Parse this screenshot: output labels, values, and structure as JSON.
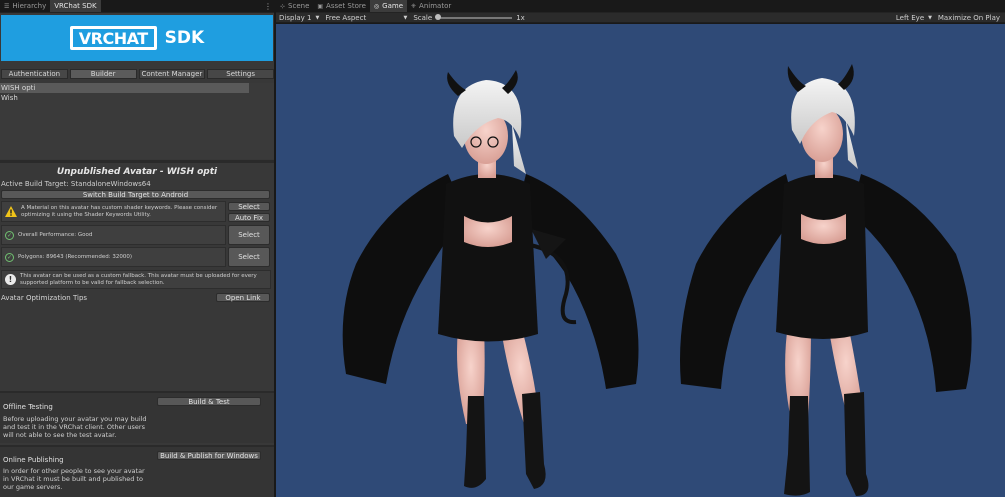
{
  "left_tabs": [
    {
      "label": "Hierarchy",
      "icon": "list-icon"
    },
    {
      "label": "VRChat SDK",
      "icon": ""
    }
  ],
  "banner": {
    "logo_text": "VRCHAT",
    "sdk_text": "SDK",
    "color": "#1f9ee0"
  },
  "sdk_tabs": [
    "Authentication",
    "Builder",
    "Content Manager",
    "Settings"
  ],
  "selected_tab": "Builder",
  "avatars": [
    "WISH opti",
    "Wish"
  ],
  "builder": {
    "title": "Unpublished Avatar - WISH opti",
    "build_target": "Active Build Target: StandaloneWindows64",
    "switch_button": "Switch Build Target to Android",
    "warning_text": "A Material on this avatar has custom shader keywords. Please consider optimizing it using the Shader Keywords Utility.",
    "select_label": "Select",
    "autofix_label": "Auto Fix",
    "performance_text": "Overall Performance: Good",
    "polygons_text": "Polygons: 89643 (Recommended: 32000)",
    "fallback_text": "This avatar can be used as a custom fallback. This avatar must be uploaded for every supported platform to be valid for fallback selection.",
    "tips_label": "Avatar Optimization Tips",
    "open_link_label": "Open Link"
  },
  "offline": {
    "title": "Offline Testing",
    "button": "Build & Test",
    "body": "Before uploading your avatar you may build and test it in the VRChat client. Other users will not able to see the test avatar."
  },
  "online": {
    "title": "Online Publishing",
    "button": "Build & Publish for Windows",
    "body": "In order for other people to see your avatar in VRChat it must be built and published to our game servers."
  },
  "game_tabs": [
    {
      "label": "Scene",
      "icon": "scene-icon"
    },
    {
      "label": "Asset Store",
      "icon": "store-icon"
    },
    {
      "label": "Game",
      "icon": "game-icon"
    },
    {
      "label": "Animator",
      "icon": "animator-icon"
    }
  ],
  "active_game_tab": "Game",
  "toolbar": {
    "display": "Display 1",
    "aspect": "Free Aspect",
    "scale_label": "Scale",
    "scale_value": "1x",
    "eye": "Left Eye",
    "maximize": "Maximize On Play"
  },
  "colors": {
    "viewport_bg": "#2f4a77",
    "panel_bg": "#383838",
    "ok_green": "#71c171",
    "warn_yellow": "#f0c419"
  }
}
